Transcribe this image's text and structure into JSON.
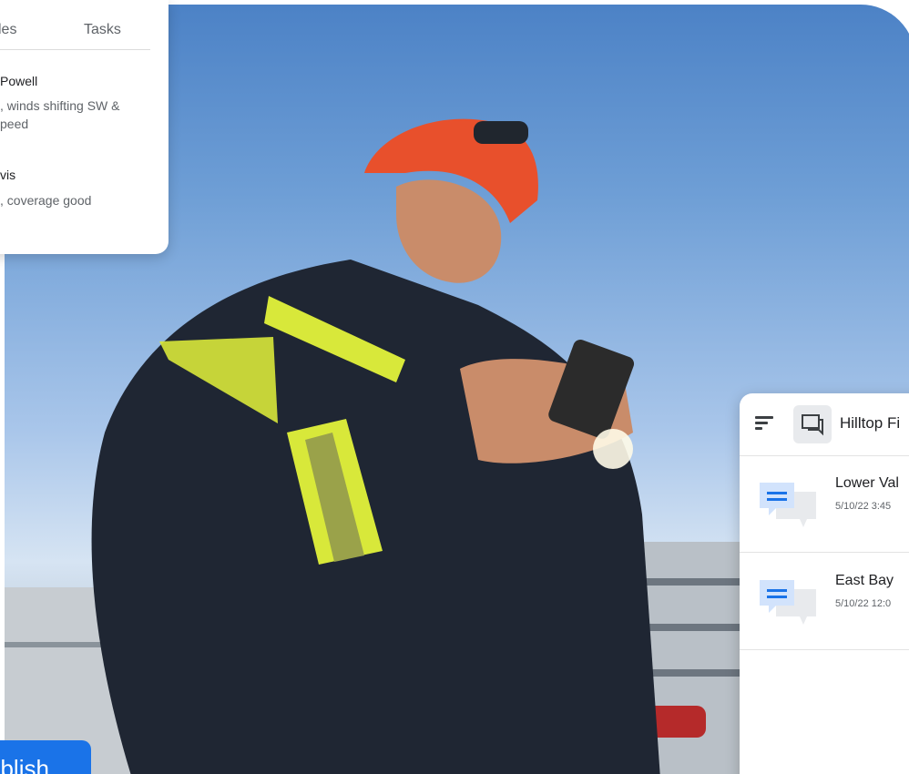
{
  "top_left_card": {
    "tabs": [
      "les",
      "Tasks"
    ],
    "messages": [
      {
        "name": "Powell",
        "line1": ", winds shifting SW &",
        "line2": "peed"
      },
      {
        "name": "vis",
        "line1": ", coverage good",
        "line2": ""
      }
    ]
  },
  "right_card": {
    "header_title": "Hilltop Fi",
    "items": [
      {
        "title": "Lower Val",
        "subtitle": "5/10/22  3:45"
      },
      {
        "title": "East Bay",
        "subtitle": "5/10/22  12:0"
      }
    ]
  },
  "publish_label": "ublish",
  "colors": {
    "accent": "#1a73e8",
    "sky": "#6f9fd6",
    "helmet": "#e8502c",
    "jacket": "#1f2633",
    "reflective": "#d8e83a"
  }
}
